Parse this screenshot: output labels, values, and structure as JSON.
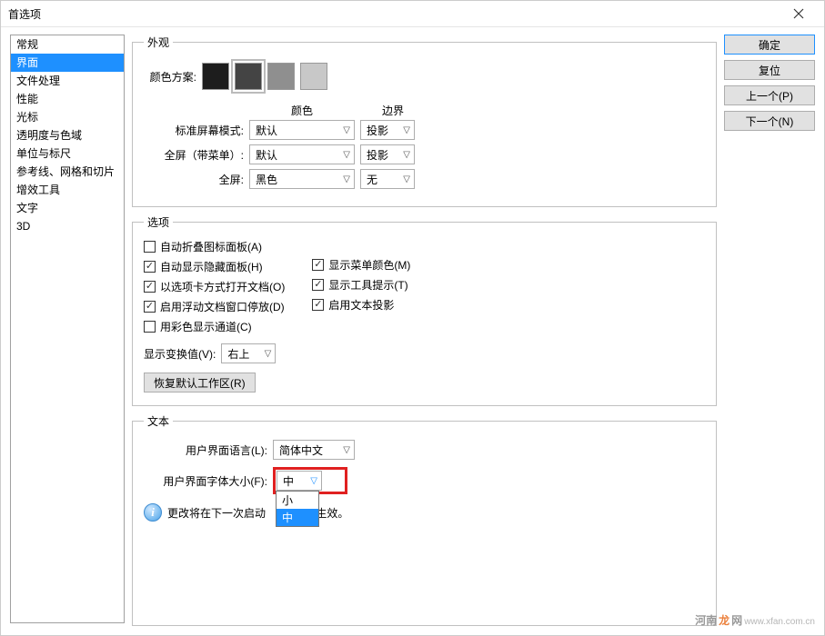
{
  "window": {
    "title": "首选项"
  },
  "sidebar": {
    "items": [
      {
        "label": "常规"
      },
      {
        "label": "界面"
      },
      {
        "label": "文件处理"
      },
      {
        "label": "性能"
      },
      {
        "label": "光标"
      },
      {
        "label": "透明度与色域"
      },
      {
        "label": "单位与标尺"
      },
      {
        "label": "参考线、网格和切片"
      },
      {
        "label": "增效工具"
      },
      {
        "label": "文字"
      },
      {
        "label": "3D"
      }
    ],
    "selected_index": 1
  },
  "buttons": {
    "ok": "确定",
    "reset": "复位",
    "prev": "上一个(P)",
    "next": "下一个(N)"
  },
  "appearance": {
    "legend": "外观",
    "scheme_label": "颜色方案:",
    "swatches": [
      "#1d1d1d",
      "#444444",
      "#8f8f8f",
      "#c8c8c8"
    ],
    "selected_swatch": 1,
    "col_color": "颜色",
    "col_border": "边界",
    "rows": [
      {
        "label": "标准屏幕模式:",
        "color": "默认",
        "border": "投影"
      },
      {
        "label": "全屏（带菜单）:",
        "color": "默认",
        "border": "投影"
      },
      {
        "label": "全屏:",
        "color": "黑色",
        "border": "无"
      }
    ]
  },
  "options": {
    "legend": "选项",
    "left": [
      {
        "label": "自动折叠图标面板(A)",
        "checked": false
      },
      {
        "label": "自动显示隐藏面板(H)",
        "checked": true
      },
      {
        "label": "以选项卡方式打开文档(O)",
        "checked": true
      },
      {
        "label": "启用浮动文档窗口停放(D)",
        "checked": true
      },
      {
        "label": "用彩色显示通道(C)",
        "checked": false
      }
    ],
    "right": [
      {
        "label": "显示菜单颜色(M)",
        "checked": true
      },
      {
        "label": "显示工具提示(T)",
        "checked": true
      },
      {
        "label": "启用文本投影",
        "checked": true
      }
    ],
    "transform_label": "显示变换值(V):",
    "transform_value": "右上",
    "restore_btn": "恢复默认工作区(R)"
  },
  "text": {
    "legend": "文本",
    "lang_label": "用户界面语言(L):",
    "lang_value": "简体中文",
    "size_label": "用户界面字体大小(F):",
    "size_value": "中",
    "size_options": [
      "小",
      "中"
    ],
    "size_hl_index": 1,
    "info_text_pre": "更改将在下一次启动",
    "info_text_post": " 时生效。"
  },
  "watermark": {
    "a": "河南",
    "b": "龙",
    "c": "网",
    "sub": "www.xfan.com.cn"
  }
}
